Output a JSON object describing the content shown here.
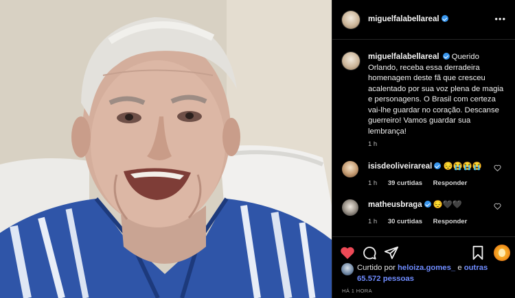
{
  "post": {
    "author": "miguelfalabellareal",
    "more_label": "•••"
  },
  "caption": {
    "author": "miguelfalabellareal",
    "text": "Querido Orlando, receba essa derradeira homenagem deste fã que cresceu acalentado por sua voz plena de magia e personagens. O Brasil com certeza vai-lhe guardar no coração. Descanse guerreiro! Vamos guardar sua lembrança!",
    "time": "1 h"
  },
  "comments": [
    {
      "author": "isisdeoliveirareal",
      "text": "😔😭😭😭",
      "time": "1 h",
      "likes": "39 curtidas",
      "reply_label": "Responder"
    },
    {
      "author": "matheusbraga",
      "text": "😔🖤🖤",
      "time": "1 h",
      "likes": "30 curtidas",
      "reply_label": "Responder"
    }
  ],
  "likes": {
    "prefix": "Curtido por",
    "user": "heloiza.gomes_",
    "joiner": "e",
    "others": "outras 65.572 pessoas"
  },
  "post_time": "HÁ 1 HORA",
  "colors": {
    "like": "#ed4956",
    "verified": "#3897f0",
    "link": "#6f8cff"
  },
  "icons": [
    "heart-icon",
    "comment-icon",
    "share-icon",
    "bookmark-icon",
    "verified-icon",
    "more-icon"
  ]
}
